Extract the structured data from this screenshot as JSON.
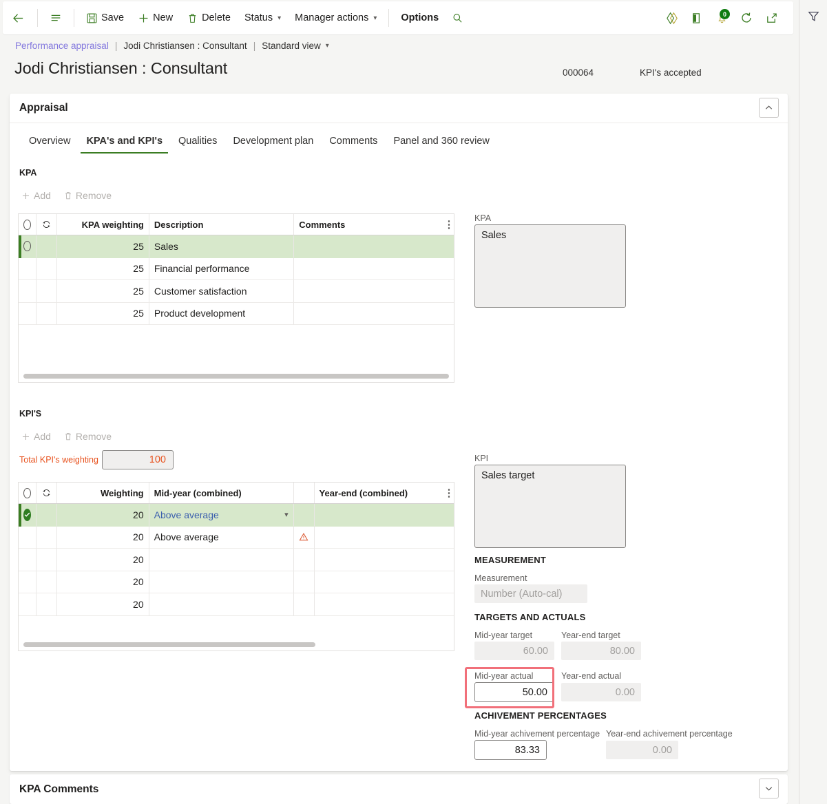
{
  "toolbar": {
    "back_label": "Back",
    "menu_label": "Show navigation",
    "save_label": "Save",
    "new_label": "New",
    "delete_label": "Delete",
    "status_label": "Status",
    "manager_actions_label": "Manager actions",
    "options_label": "Options",
    "search_label": "Search",
    "icons": [
      {
        "name": "attachments-icon",
        "glyph": "diamond"
      },
      {
        "name": "office-icon",
        "glyph": "office"
      },
      {
        "name": "notifications-icon",
        "glyph": "bell",
        "badge": "0"
      },
      {
        "name": "refresh-icon",
        "glyph": "refresh"
      },
      {
        "name": "popout-icon",
        "glyph": "popout"
      }
    ],
    "filter_icon_label": "Filter"
  },
  "breadcrumb": {
    "root": "Performance appraisal",
    "separator": "|",
    "record": "Jodi Christiansen : Consultant",
    "view": "Standard view"
  },
  "header": {
    "title": "Jodi Christiansen : Consultant",
    "record_number": "000064",
    "status": "KPI's accepted"
  },
  "appraisal": {
    "panel_title": "Appraisal",
    "tabs": [
      {
        "label": "Overview",
        "active": false
      },
      {
        "label": "KPA's and KPI's",
        "active": true
      },
      {
        "label": "Qualities",
        "active": false
      },
      {
        "label": "Development plan",
        "active": false
      },
      {
        "label": "Comments",
        "active": false
      },
      {
        "label": "Panel and 360 review",
        "active": false
      }
    ]
  },
  "kpa_section": {
    "label": "KPA",
    "add_label": "Add",
    "remove_label": "Remove",
    "columns": [
      "",
      "",
      "KPA weighting",
      "Description",
      "Comments",
      ""
    ],
    "rows": [
      {
        "weighting": "25",
        "description": "Sales",
        "comments": "",
        "selected": true
      },
      {
        "weighting": "25",
        "description": "Financial performance",
        "comments": "",
        "selected": false
      },
      {
        "weighting": "25",
        "description": "Customer satisfaction",
        "comments": "",
        "selected": false
      },
      {
        "weighting": "25",
        "description": "Product development",
        "comments": "",
        "selected": false
      }
    ]
  },
  "kpa_detail": {
    "label": "KPA",
    "value": "Sales"
  },
  "kpi_section": {
    "label": "KPI'S",
    "add_label": "Add",
    "remove_label": "Remove",
    "total_weighting_label": "Total KPI's weighting",
    "total_weighting_value": "100",
    "columns": [
      "",
      "",
      "Weighting",
      "Mid-year (combined)",
      "",
      "Year-end (combined)",
      ""
    ],
    "rows": [
      {
        "weighting": "20",
        "midyear": "Above average",
        "yearend": "",
        "selected": true,
        "dropdown": true,
        "warning": false
      },
      {
        "weighting": "20",
        "midyear": "Above average",
        "yearend": "",
        "selected": false,
        "dropdown": false,
        "warning": true
      },
      {
        "weighting": "20",
        "midyear": "",
        "yearend": "",
        "selected": false,
        "dropdown": false,
        "warning": false
      },
      {
        "weighting": "20",
        "midyear": "",
        "yearend": "",
        "selected": false,
        "dropdown": false,
        "warning": false
      },
      {
        "weighting": "20",
        "midyear": "",
        "yearend": "",
        "selected": false,
        "dropdown": false,
        "warning": false
      }
    ]
  },
  "kpi_detail": {
    "label": "KPI",
    "value": "Sales target",
    "measurement_group": "MEASUREMENT",
    "measurement_label": "Measurement",
    "measurement_value": "Number (Auto-cal)",
    "targets_group": "TARGETS AND ACTUALS",
    "midyear_target_label": "Mid-year target",
    "midyear_target_value": "60.00",
    "yearend_target_label": "Year-end target",
    "yearend_target_value": "80.00",
    "midyear_actual_label": "Mid-year actual",
    "midyear_actual_value": "50.00",
    "yearend_actual_label": "Year-end actual",
    "yearend_actual_value": "0.00",
    "achievement_group": "ACHIVEMENT PERCENTAGES",
    "midyear_pct_label": "Mid-year achivement percentage",
    "midyear_pct_value": "83.33",
    "yearend_pct_label": "Year-end achivement percentage",
    "yearend_pct_value": "0.00"
  },
  "kpa_comments": {
    "title": "KPA Comments",
    "expand_label": "Expand"
  },
  "colors": {
    "accent_green": "#3b7d23",
    "selected_row": "#d7e8cb",
    "link_blue": "#3b5fad",
    "warning_orange": "#d94f26",
    "total_red": "#e8531f",
    "highlight_red": "#f1707a",
    "breadcrumb_purple": "#8378de"
  }
}
